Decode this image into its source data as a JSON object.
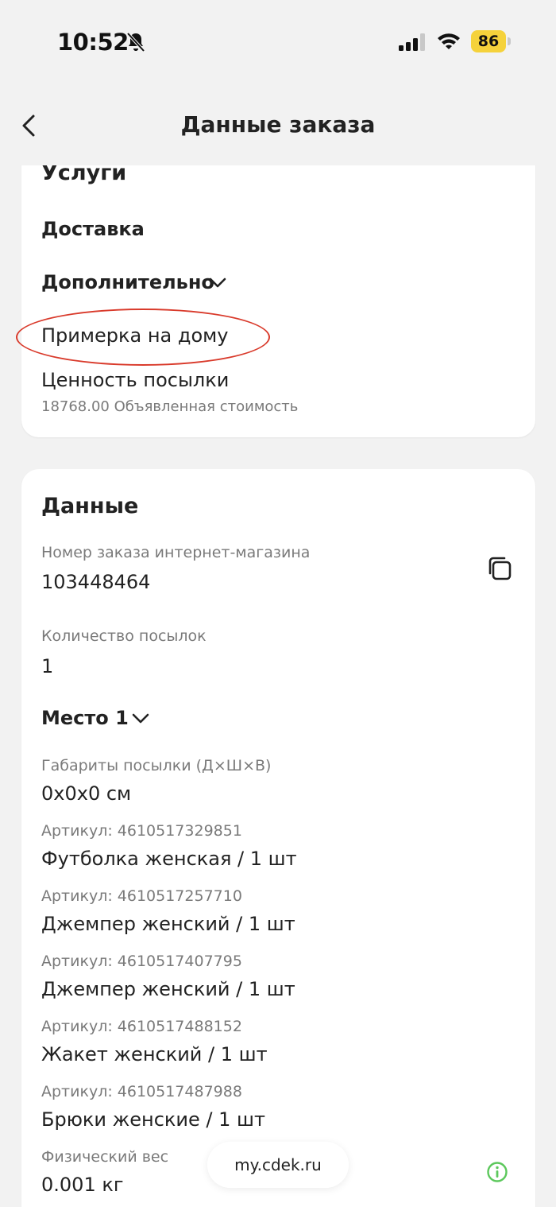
{
  "status_bar": {
    "time": "10:52",
    "battery": "86"
  },
  "nav": {
    "title": "Данные заказа"
  },
  "services": {
    "title": "Услуги",
    "delivery": "Доставка",
    "additional": "Дополнительно",
    "fitting": "Примерка на дому",
    "parcel_value_label": "Ценность посылки",
    "parcel_value_note": "18768.00 Объявленная стоимость"
  },
  "data_section": {
    "title": "Данные",
    "order_number_label": "Номер заказа интернет-магазина",
    "order_number": "103448464",
    "parcels_count_label": "Количество посылок",
    "parcels_count": "1",
    "place": "Место 1",
    "dimensions_label": "Габариты посылки (Д×Ш×В)",
    "dimensions": "0x0x0 см",
    "items": [
      {
        "article": "Артикул: 4610517329851",
        "name": "Футболка женская / 1 шт"
      },
      {
        "article": "Артикул: 4610517257710",
        "name": "Джемпер женский / 1 шт"
      },
      {
        "article": "Артикул: 4610517407795",
        "name": "Джемпер женский / 1 шт"
      },
      {
        "article": "Артикул: 4610517488152",
        "name": "Жакет женский / 1 шт"
      },
      {
        "article": "Артикул: 4610517487988",
        "name": "Брюки женские / 1 шт"
      }
    ],
    "weight_label": "Физический вес",
    "weight": "0.001 кг"
  },
  "browser": {
    "url": "my.cdek.ru"
  },
  "colors": {
    "highlight": "#d93a2b",
    "info": "#5cc85c",
    "battery": "#f5d23b"
  }
}
